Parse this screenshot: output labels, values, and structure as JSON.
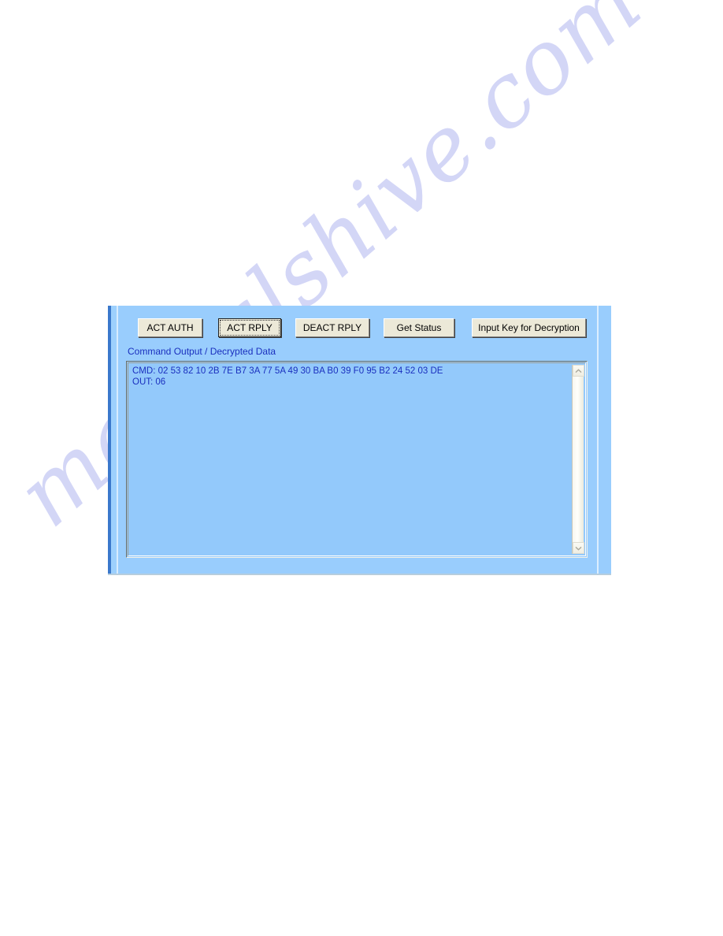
{
  "page": {
    "background_color": "#ffffff",
    "watermark_text": "manualshive.com",
    "watermark_color": "#b9bdf2"
  },
  "panel": {
    "background_color": "#99cdfd",
    "left_edge_color": "#3a78cc",
    "label_color": "#1a2fbe"
  },
  "toolbar": {
    "buttons": [
      {
        "id": "act-auth",
        "label": "ACT AUTH",
        "focused": false
      },
      {
        "id": "act-rply",
        "label": "ACT RPLY",
        "focused": true
      },
      {
        "id": "deact-rply",
        "label": "DEACT RPLY",
        "focused": false
      },
      {
        "id": "get-status",
        "label": "Get Status",
        "focused": false
      },
      {
        "id": "input-key",
        "label": "Input Key for Decryption",
        "focused": false
      }
    ]
  },
  "output": {
    "label": "Command Output / Decrypted Data",
    "text": "CMD: 02 53 82 10 2B 7E B7 3A 77 5A 49 30 BA B0 39 F0 95 B2 24 52 03 DE\nOUT: 06",
    "lines": [
      "CMD: 02 53 82 10 2B 7E B7 3A 77 5A 49 30 BA B0 39 F0 95 B2 24 52 03 DE",
      "OUT: 06"
    ],
    "text_color": "#1a2fbe",
    "background_color": "#93c9fb",
    "scrollbar": {
      "orientation": "vertical",
      "up_arrow_icon": "chevron-up-icon",
      "down_arrow_icon": "chevron-down-icon",
      "position": 0
    }
  }
}
